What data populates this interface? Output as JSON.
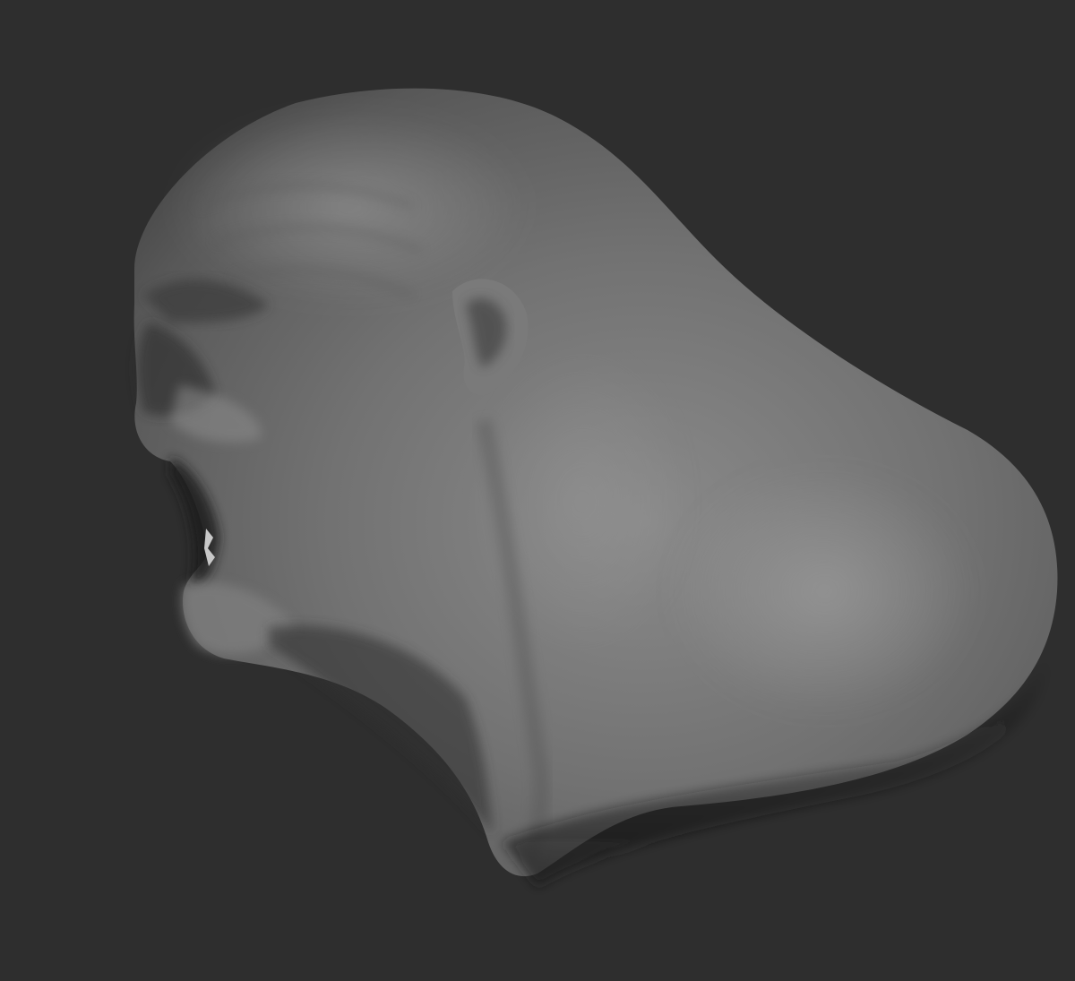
{
  "viewport": {
    "background_color": "#2e2e2e",
    "model_base_color": "#6e6e6e",
    "model_highlight_color": "#8e8e8e",
    "model_shadow_color": "#3a3a3a",
    "subject": "sculpt-bust"
  }
}
